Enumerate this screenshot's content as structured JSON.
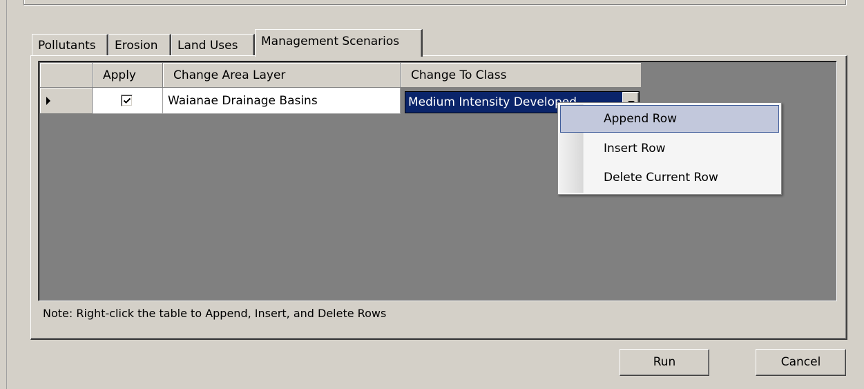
{
  "tabs": [
    {
      "label": "Pollutants"
    },
    {
      "label": "Erosion"
    },
    {
      "label": "Land Uses"
    },
    {
      "label": "Management Scenarios",
      "active": true
    }
  ],
  "grid": {
    "columns": [
      "",
      "Apply",
      "Change Area Layer",
      "Change To Class"
    ],
    "rows": [
      {
        "current": true,
        "apply": true,
        "change_area_layer": "Waianae Drainage Basins",
        "change_to_class": "Medium Intensity Developed"
      }
    ]
  },
  "context_menu": {
    "items": [
      {
        "label": "Append Row",
        "highlighted": true
      },
      {
        "label": "Insert Row"
      },
      {
        "label": "Delete Current Row"
      }
    ]
  },
  "note": "Note: Right-click the table to Append, Insert, and Delete Rows",
  "buttons": {
    "run": "Run",
    "cancel": "Cancel"
  },
  "colors": {
    "face": "#d4d0c8",
    "grid_background": "#808080",
    "selection": "#0a246a",
    "menu_highlight": "#c2c8dc",
    "menu_highlight_border": "#3f5c9a"
  }
}
